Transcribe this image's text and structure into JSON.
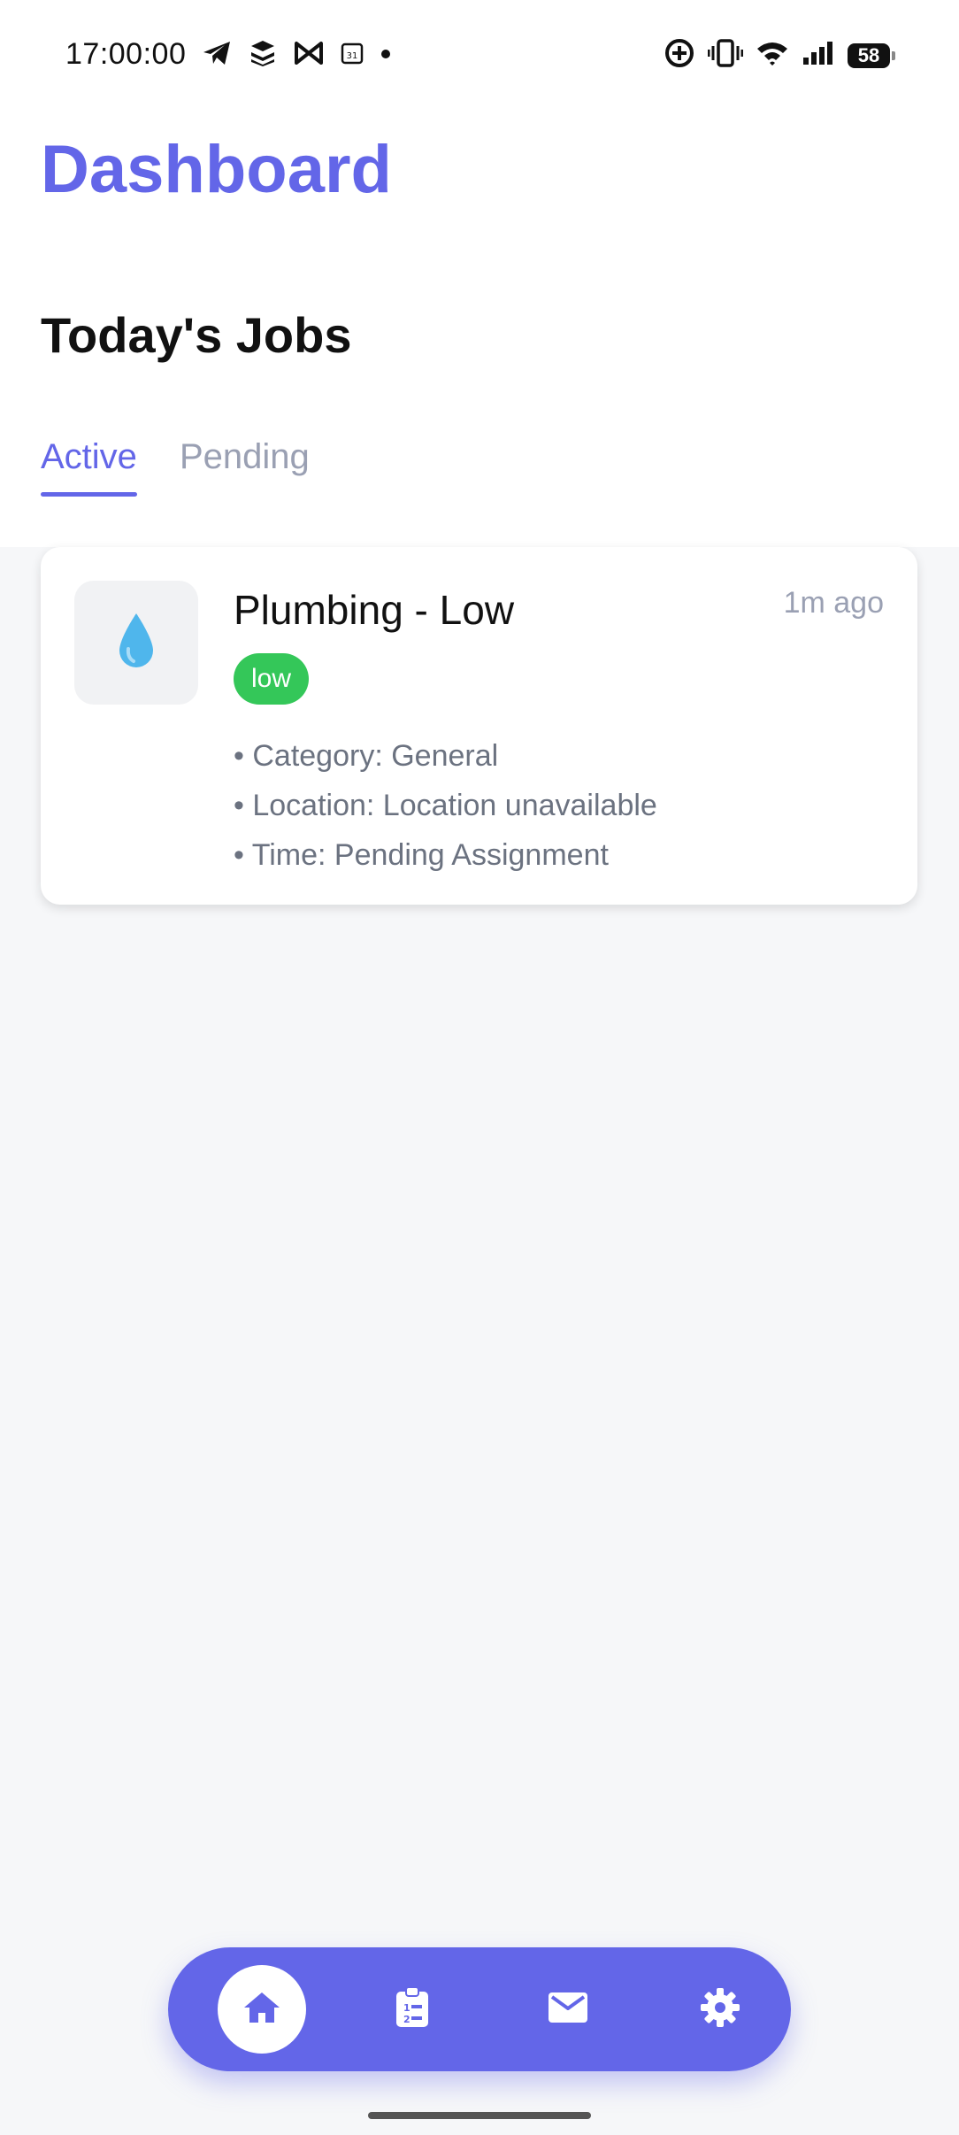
{
  "status_bar": {
    "time": "17:00:00",
    "battery": "58"
  },
  "header": {
    "title": "Dashboard"
  },
  "section": {
    "title": "Today's Jobs"
  },
  "tabs": [
    {
      "label": "Active",
      "active": true
    },
    {
      "label": "Pending",
      "active": false
    }
  ],
  "jobs": [
    {
      "title": "Plumbing - Low",
      "time_ago": "1m ago",
      "priority": "low",
      "icon": "water-drop-icon",
      "details": [
        "Category: General",
        "Location: Location unavailable",
        "Time: Pending Assignment"
      ]
    }
  ],
  "bottom_nav": {
    "items": [
      {
        "icon": "home-icon",
        "active": true
      },
      {
        "icon": "clipboard-list-icon",
        "active": false
      },
      {
        "icon": "mail-icon",
        "active": false
      },
      {
        "icon": "gear-icon",
        "active": false
      }
    ]
  },
  "colors": {
    "accent": "#6366e8",
    "badge_low": "#34c759",
    "background": "#f6f7f9"
  }
}
